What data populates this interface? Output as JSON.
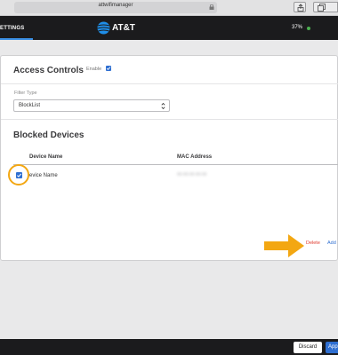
{
  "browser": {
    "url": "attwifimanager"
  },
  "header": {
    "settings_tab": "ETTINGS",
    "brand": "AT&T",
    "battery": "37%"
  },
  "access_controls": {
    "title": "Access Controls",
    "enable_label": "Enable",
    "enabled": true,
    "filter_type_label": "Filter Type",
    "filter_type_value": "BlockList"
  },
  "blocked_devices": {
    "title": "Blocked Devices",
    "columns": [
      "Device Name",
      "MAC Address"
    ],
    "rows": [
      {
        "device_name": "evice Name",
        "mac_address": "00:00:00:00:00",
        "checked": true
      }
    ],
    "delete_label": "Delete",
    "add_label": "Add"
  },
  "footer": {
    "discard_label": "Discard",
    "apply_label": "App"
  },
  "colors": {
    "accent": "#2f6fd1",
    "annotation": "#f3a712",
    "delete": "#e03b2f"
  }
}
